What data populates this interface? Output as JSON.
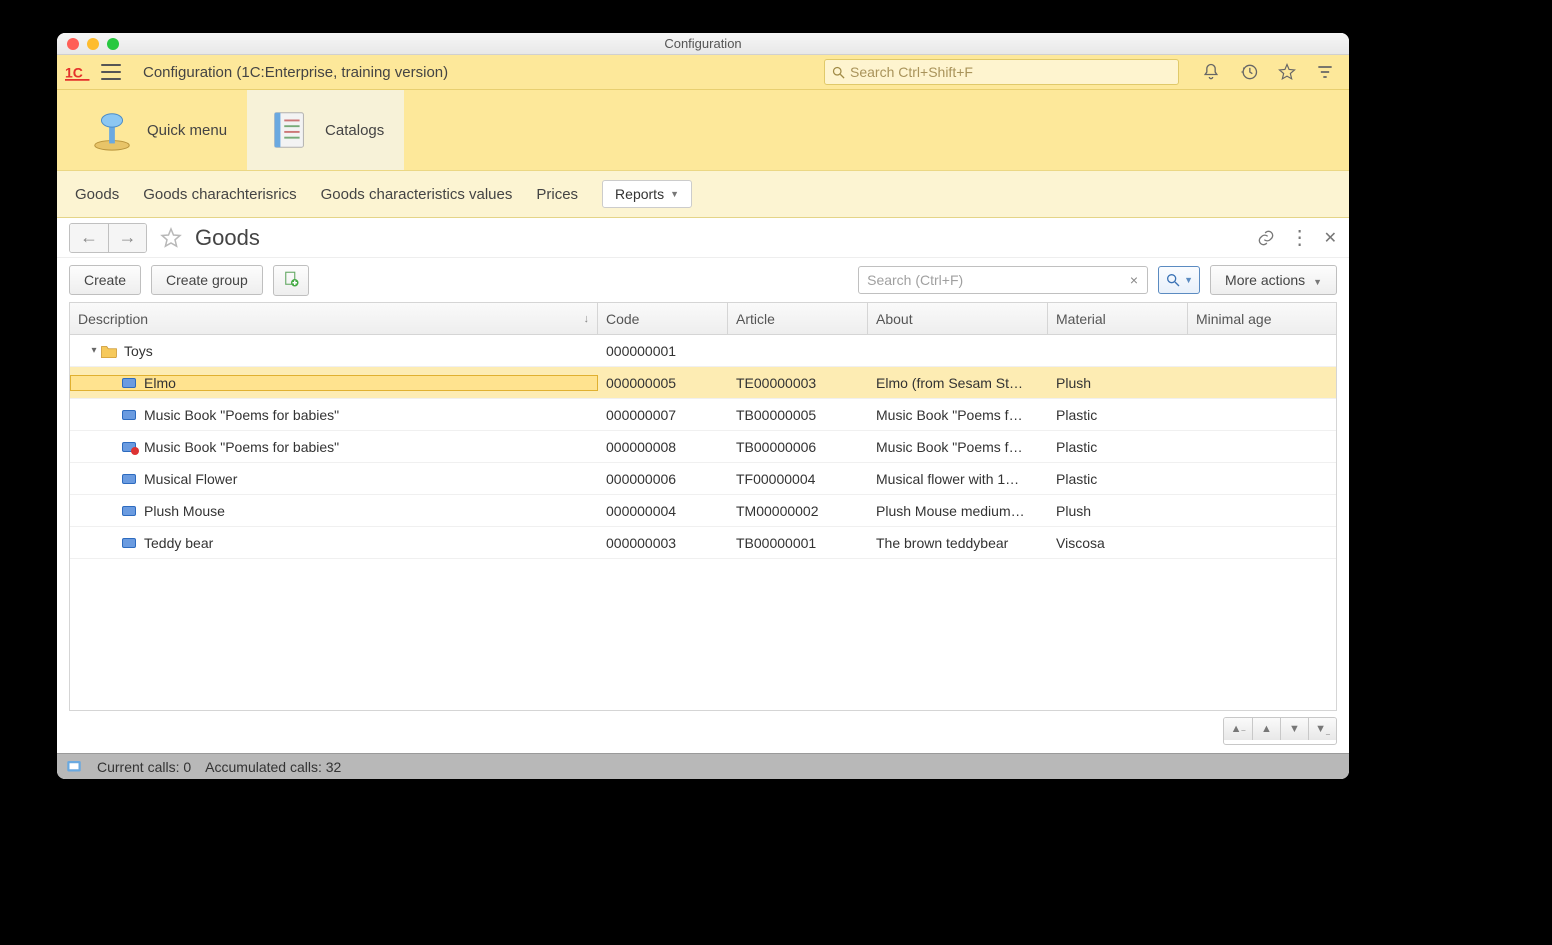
{
  "window_title": "Configuration",
  "header": {
    "app_title": "Configuration  (1C:Enterprise, training version)",
    "search_placeholder": "Search Ctrl+Shift+F"
  },
  "sections": [
    {
      "id": "quick-menu",
      "label": "Quick menu",
      "active": false
    },
    {
      "id": "catalogs",
      "label": "Catalogs",
      "active": true
    }
  ],
  "subnav": {
    "items": [
      "Goods",
      "Goods charachterisrics",
      "Goods characteristics values",
      "Prices"
    ],
    "reports_label": "Reports"
  },
  "form": {
    "title": "Goods",
    "create_label": "Create",
    "create_group_label": "Create group",
    "search_placeholder": "Search (Ctrl+F)",
    "more_actions_label": "More actions"
  },
  "table": {
    "columns": {
      "description": "Description",
      "code": "Code",
      "article": "Article",
      "about": "About",
      "material": "Material",
      "minimal_age": "Minimal age"
    },
    "group": {
      "description": "Toys",
      "code": "000000001"
    },
    "rows": [
      {
        "description": "Elmo",
        "code": "000000005",
        "article": "TE00000003",
        "about": "Elmo (from Sesam St…",
        "material": "Plush",
        "minimal_age": "",
        "selected": true,
        "deleted": false
      },
      {
        "description": "Music Book \"Poems for babies\"",
        "code": "000000007",
        "article": "TB00000005",
        "about": "Music Book \"Poems f…",
        "material": "Plastic",
        "minimal_age": "",
        "selected": false,
        "deleted": false
      },
      {
        "description": "Music Book \"Poems for babies\"",
        "code": "000000008",
        "article": "TB00000006",
        "about": "Music Book \"Poems f…",
        "material": "Plastic",
        "minimal_age": "",
        "selected": false,
        "deleted": true
      },
      {
        "description": "Musical Flower",
        "code": "000000006",
        "article": "TF00000004",
        "about": "Musical flower with 1…",
        "material": "Plastic",
        "minimal_age": "",
        "selected": false,
        "deleted": false
      },
      {
        "description": "Plush Mouse",
        "code": "000000004",
        "article": "TM00000002",
        "about": "Plush Mouse medium…",
        "material": "Plush",
        "minimal_age": "",
        "selected": false,
        "deleted": false
      },
      {
        "description": "Teddy bear",
        "code": "000000003",
        "article": "TB00000001",
        "about": "The brown teddybear",
        "material": "Viscosa",
        "minimal_age": "",
        "selected": false,
        "deleted": false
      }
    ]
  },
  "status": {
    "current_calls": "Current calls: 0",
    "accumulated_calls": "Accumulated calls: 32"
  }
}
